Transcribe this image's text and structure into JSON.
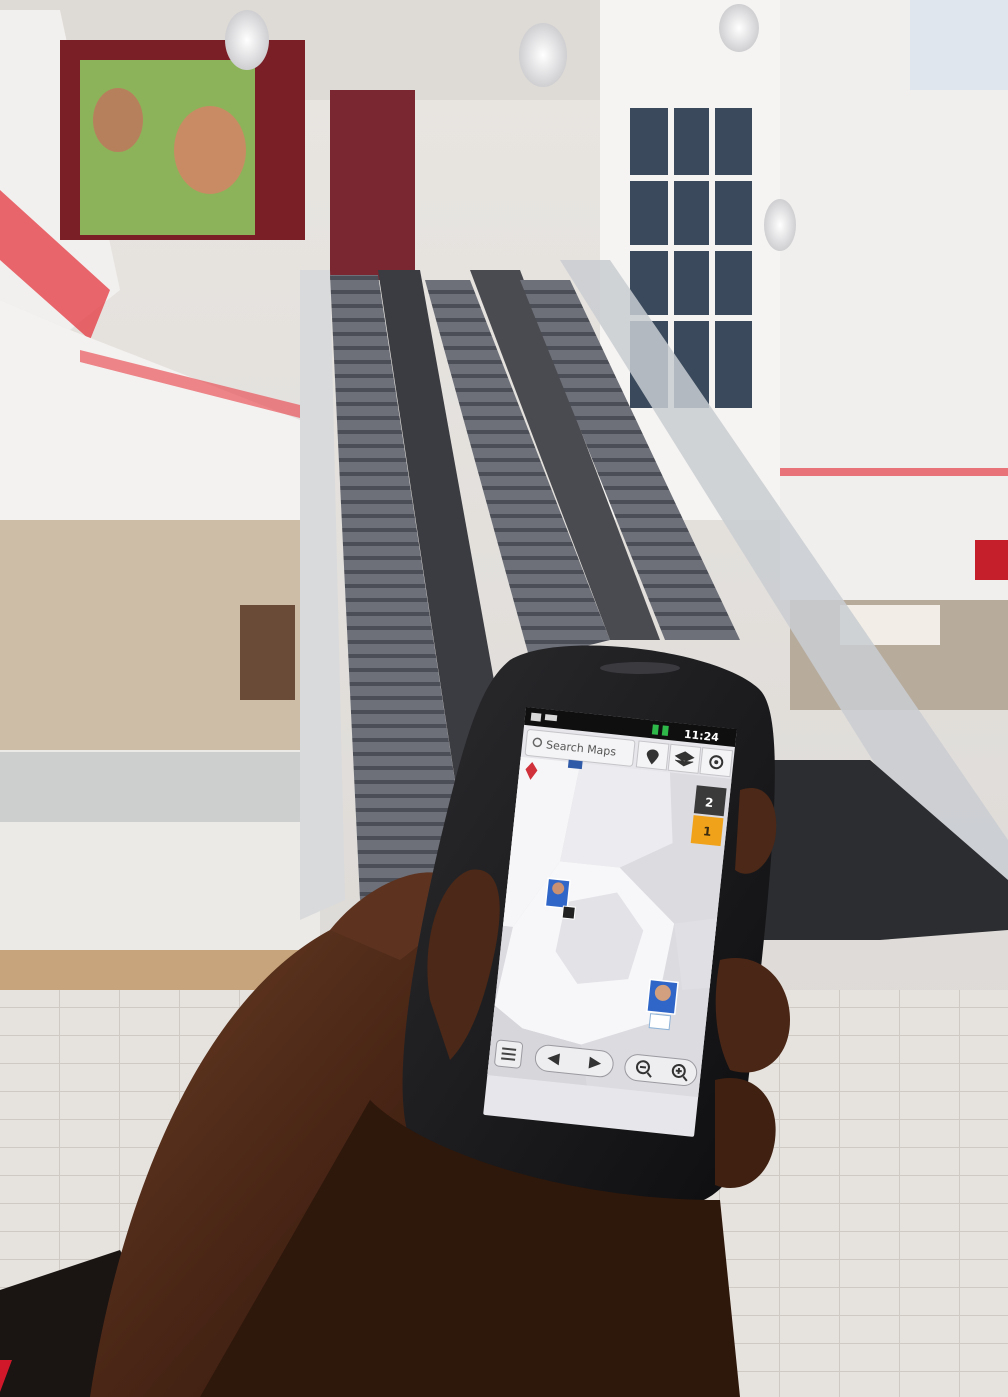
{
  "photo": {
    "subject": "hand-holding-phone-in-mall-atrium"
  },
  "status_bar": {
    "time": "11:24"
  },
  "maps": {
    "search_placeholder": "Search Maps",
    "floors": [
      "2",
      "1"
    ],
    "selected_floor": "1",
    "icons": {
      "search": "search-icon",
      "places": "pin-icon",
      "layers": "layers-icon",
      "my_location": "my-location-icon",
      "list": "list-icon",
      "back": "arrow-left-icon",
      "forward": "arrow-right-icon",
      "zoom_out": "zoom-out-icon",
      "zoom_in": "zoom-in-icon"
    }
  },
  "colors": {
    "floor_selected": "#f0a21a",
    "floor_unselected": "#3a3a3a",
    "map_background": "#e7e6ea",
    "map_floor": "#f6f6f8",
    "accent_red": "#e0303a"
  }
}
